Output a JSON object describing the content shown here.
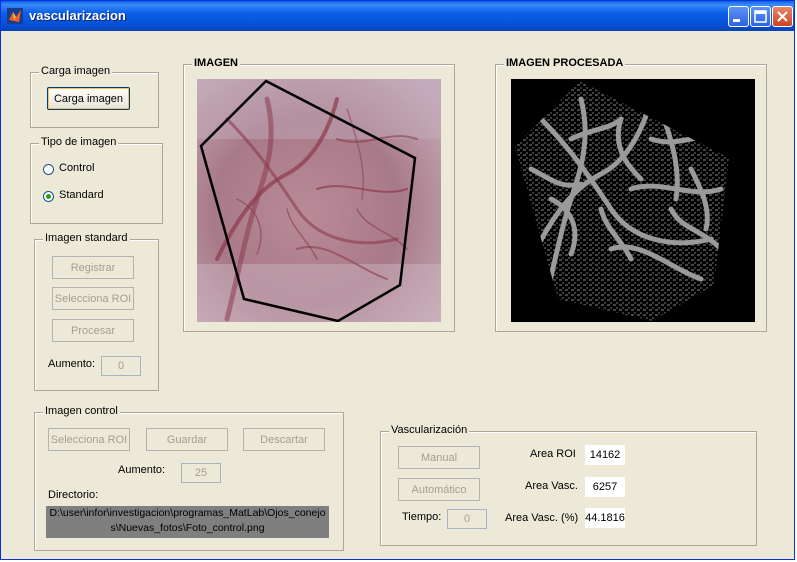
{
  "window": {
    "title": "vascularizacion"
  },
  "carga": {
    "group_title": "Carga imagen",
    "button": "Carga imagen"
  },
  "tipo": {
    "group_title": "Tipo de imagen",
    "options": [
      {
        "label": "Control",
        "selected": false
      },
      {
        "label": "Standard",
        "selected": true
      }
    ]
  },
  "standard": {
    "group_title": "Imagen standard",
    "registrar": "Registrar",
    "selecciona_roi": "Selecciona ROI",
    "procesar": "Procesar",
    "aumento_label": "Aumento:",
    "aumento_value": "0"
  },
  "imagen": {
    "title": "IMAGEN"
  },
  "procesada": {
    "title": "IMAGEN PROCESADA"
  },
  "control": {
    "group_title": "Imagen control",
    "selecciona_roi": "Selecciona ROI",
    "guardar": "Guardar",
    "descartar": "Descartar",
    "aumento_label": "Aumento:",
    "aumento_value": "25",
    "directorio_label": "Directorio:",
    "directorio_line1": "D:\\user\\infor\\investigacion\\programas_MatLab\\Ojos_conejo",
    "directorio_line2": "s\\Nuevas_fotos\\Foto_control.png"
  },
  "vasc": {
    "group_title": "Vascularización",
    "manual": "Manual",
    "automatico": "Automático",
    "tiempo_label": "Tiempo:",
    "tiempo_value": "0",
    "area_roi_label": "Area ROI",
    "area_roi_value": "14162",
    "area_vasc_label": "Area Vasc.",
    "area_vasc_value": "6257",
    "area_vasc_pct_label": "Area Vasc. (%)",
    "area_vasc_pct_value": "44.1816"
  },
  "colors": {
    "titlebar": "#0a5ee8",
    "radio_selected": "#21a121",
    "processed_bg": "#000000",
    "roi_outline": "#000000"
  }
}
